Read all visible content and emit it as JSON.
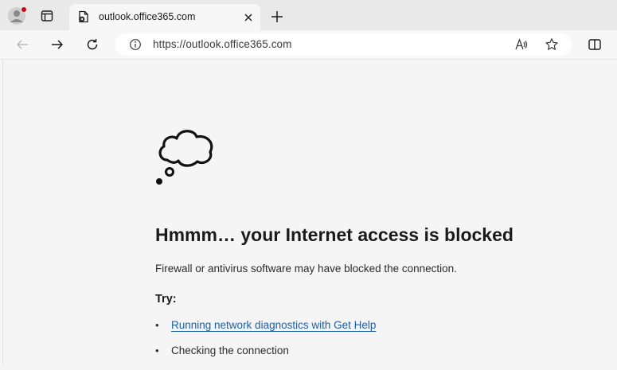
{
  "browser": {
    "tab": {
      "title": "outlook.office365.com",
      "favicon": "page-error-icon"
    },
    "toolbar": {
      "url": "https://outlook.office365.com",
      "icons": [
        "back-icon",
        "forward-icon",
        "refresh-icon",
        "site-info-icon",
        "read-aloud-icon",
        "favorite-star-icon",
        "split-screen-icon"
      ]
    },
    "profile_badge_color": "#d0021b"
  },
  "error_page": {
    "icon": "thought-cloud-icon",
    "heading": "Hmmm… your Internet access is blocked",
    "description": "Firewall or antivirus software may have blocked the connection.",
    "try_label": "Try:",
    "suggestions": [
      {
        "text": "Running network diagnostics with Get Help",
        "is_link": true
      },
      {
        "text": "Checking the connection",
        "is_link": false
      }
    ],
    "link_color": "#1d5fa8"
  }
}
